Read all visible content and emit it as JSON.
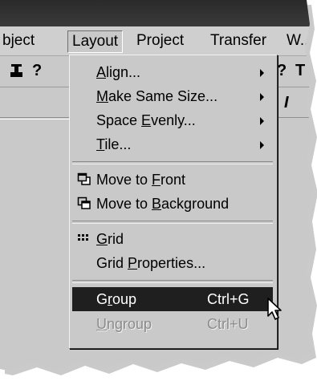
{
  "menubar": {
    "items": [
      {
        "label": "bject"
      },
      {
        "label": "Layout"
      },
      {
        "label": "Project"
      },
      {
        "label": "Transfer"
      },
      {
        "label": "W.."
      }
    ]
  },
  "toolbar": {
    "help_glyph": "?",
    "right_glyphs": [
      "?",
      "T",
      "I"
    ]
  },
  "layout_menu": {
    "items": [
      {
        "pre": "",
        "accel": "A",
        "post": "lign...",
        "has_submenu": true
      },
      {
        "pre": "",
        "accel": "M",
        "post": "ake Same Size...",
        "has_submenu": true
      },
      {
        "pre": "Space ",
        "accel": "E",
        "post": "venly...",
        "has_submenu": true
      },
      {
        "pre": "",
        "accel": "T",
        "post": "ile...",
        "has_submenu": true
      },
      {
        "pre": "Move to ",
        "accel": "F",
        "post": "ront"
      },
      {
        "pre": "Move to ",
        "accel": "B",
        "post": "ackground"
      },
      {
        "pre": "",
        "accel": "G",
        "post": "rid"
      },
      {
        "pre": "Grid ",
        "accel": "P",
        "post": "roperties..."
      },
      {
        "pre": "G",
        "accel": "r",
        "post": "oup",
        "shortcut": "Ctrl+G",
        "state": "highlighted"
      },
      {
        "pre": "",
        "accel": "U",
        "post": "ngroup",
        "shortcut": "Ctrl+U",
        "state": "disabled"
      }
    ]
  },
  "colors": {
    "menu_bg": "#c9c9c9",
    "highlight_bg": "#1f1f1f",
    "disabled_text": "#8c8c8c"
  }
}
